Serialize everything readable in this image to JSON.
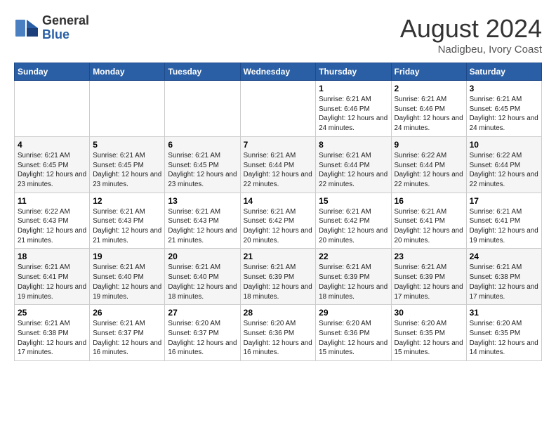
{
  "logo": {
    "general": "General",
    "blue": "Blue"
  },
  "header": {
    "month_year": "August 2024",
    "location": "Nadigbeu, Ivory Coast"
  },
  "days_of_week": [
    "Sunday",
    "Monday",
    "Tuesday",
    "Wednesday",
    "Thursday",
    "Friday",
    "Saturday"
  ],
  "weeks": [
    [
      {
        "day": "",
        "content": ""
      },
      {
        "day": "",
        "content": ""
      },
      {
        "day": "",
        "content": ""
      },
      {
        "day": "",
        "content": ""
      },
      {
        "day": "1",
        "content": "Sunrise: 6:21 AM\nSunset: 6:46 PM\nDaylight: 12 hours\nand 24 minutes."
      },
      {
        "day": "2",
        "content": "Sunrise: 6:21 AM\nSunset: 6:46 PM\nDaylight: 12 hours\nand 24 minutes."
      },
      {
        "day": "3",
        "content": "Sunrise: 6:21 AM\nSunset: 6:45 PM\nDaylight: 12 hours\nand 24 minutes."
      }
    ],
    [
      {
        "day": "4",
        "content": "Sunrise: 6:21 AM\nSunset: 6:45 PM\nDaylight: 12 hours\nand 23 minutes."
      },
      {
        "day": "5",
        "content": "Sunrise: 6:21 AM\nSunset: 6:45 PM\nDaylight: 12 hours\nand 23 minutes."
      },
      {
        "day": "6",
        "content": "Sunrise: 6:21 AM\nSunset: 6:45 PM\nDaylight: 12 hours\nand 23 minutes."
      },
      {
        "day": "7",
        "content": "Sunrise: 6:21 AM\nSunset: 6:44 PM\nDaylight: 12 hours\nand 22 minutes."
      },
      {
        "day": "8",
        "content": "Sunrise: 6:21 AM\nSunset: 6:44 PM\nDaylight: 12 hours\nand 22 minutes."
      },
      {
        "day": "9",
        "content": "Sunrise: 6:22 AM\nSunset: 6:44 PM\nDaylight: 12 hours\nand 22 minutes."
      },
      {
        "day": "10",
        "content": "Sunrise: 6:22 AM\nSunset: 6:44 PM\nDaylight: 12 hours\nand 22 minutes."
      }
    ],
    [
      {
        "day": "11",
        "content": "Sunrise: 6:22 AM\nSunset: 6:43 PM\nDaylight: 12 hours\nand 21 minutes."
      },
      {
        "day": "12",
        "content": "Sunrise: 6:21 AM\nSunset: 6:43 PM\nDaylight: 12 hours\nand 21 minutes."
      },
      {
        "day": "13",
        "content": "Sunrise: 6:21 AM\nSunset: 6:43 PM\nDaylight: 12 hours\nand 21 minutes."
      },
      {
        "day": "14",
        "content": "Sunrise: 6:21 AM\nSunset: 6:42 PM\nDaylight: 12 hours\nand 20 minutes."
      },
      {
        "day": "15",
        "content": "Sunrise: 6:21 AM\nSunset: 6:42 PM\nDaylight: 12 hours\nand 20 minutes."
      },
      {
        "day": "16",
        "content": "Sunrise: 6:21 AM\nSunset: 6:41 PM\nDaylight: 12 hours\nand 20 minutes."
      },
      {
        "day": "17",
        "content": "Sunrise: 6:21 AM\nSunset: 6:41 PM\nDaylight: 12 hours\nand 19 minutes."
      }
    ],
    [
      {
        "day": "18",
        "content": "Sunrise: 6:21 AM\nSunset: 6:41 PM\nDaylight: 12 hours\nand 19 minutes."
      },
      {
        "day": "19",
        "content": "Sunrise: 6:21 AM\nSunset: 6:40 PM\nDaylight: 12 hours\nand 19 minutes."
      },
      {
        "day": "20",
        "content": "Sunrise: 6:21 AM\nSunset: 6:40 PM\nDaylight: 12 hours\nand 18 minutes."
      },
      {
        "day": "21",
        "content": "Sunrise: 6:21 AM\nSunset: 6:39 PM\nDaylight: 12 hours\nand 18 minutes."
      },
      {
        "day": "22",
        "content": "Sunrise: 6:21 AM\nSunset: 6:39 PM\nDaylight: 12 hours\nand 18 minutes."
      },
      {
        "day": "23",
        "content": "Sunrise: 6:21 AM\nSunset: 6:39 PM\nDaylight: 12 hours\nand 17 minutes."
      },
      {
        "day": "24",
        "content": "Sunrise: 6:21 AM\nSunset: 6:38 PM\nDaylight: 12 hours\nand 17 minutes."
      }
    ],
    [
      {
        "day": "25",
        "content": "Sunrise: 6:21 AM\nSunset: 6:38 PM\nDaylight: 12 hours\nand 17 minutes."
      },
      {
        "day": "26",
        "content": "Sunrise: 6:21 AM\nSunset: 6:37 PM\nDaylight: 12 hours\nand 16 minutes."
      },
      {
        "day": "27",
        "content": "Sunrise: 6:20 AM\nSunset: 6:37 PM\nDaylight: 12 hours\nand 16 minutes."
      },
      {
        "day": "28",
        "content": "Sunrise: 6:20 AM\nSunset: 6:36 PM\nDaylight: 12 hours\nand 16 minutes."
      },
      {
        "day": "29",
        "content": "Sunrise: 6:20 AM\nSunset: 6:36 PM\nDaylight: 12 hours\nand 15 minutes."
      },
      {
        "day": "30",
        "content": "Sunrise: 6:20 AM\nSunset: 6:35 PM\nDaylight: 12 hours\nand 15 minutes."
      },
      {
        "day": "31",
        "content": "Sunrise: 6:20 AM\nSunset: 6:35 PM\nDaylight: 12 hours\nand 14 minutes."
      }
    ]
  ]
}
